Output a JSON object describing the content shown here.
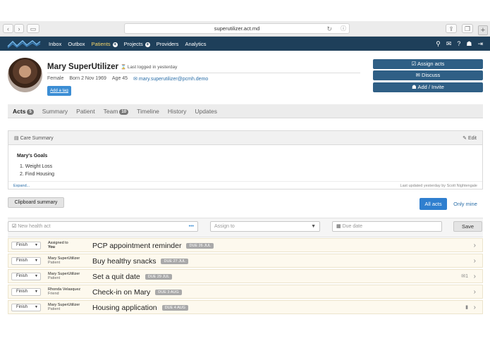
{
  "browser": {
    "url": "superutilizer.act.md"
  },
  "nav": {
    "links": [
      "Inbox",
      "Outbox",
      "Patients",
      "Projects",
      "Providers",
      "Analytics"
    ],
    "active": "Patients"
  },
  "profile": {
    "name": "Mary SuperUtilizer",
    "last_logged": "Last logged in yesterday",
    "gender": "Female",
    "born": "Born 2 Nov 1969",
    "age": "Age 45",
    "email": "mary.superutilizer@pcmh.demo",
    "tag_button": "Add a tag"
  },
  "actions": {
    "assign": "Assign acts",
    "discuss": "Discuss",
    "add_invite": "Add / Invite"
  },
  "tabs": [
    {
      "label": "Acts",
      "badge": "5"
    },
    {
      "label": "Summary",
      "badge": ""
    },
    {
      "label": "Patient",
      "badge": ""
    },
    {
      "label": "Team",
      "badge": "10"
    },
    {
      "label": "Timeline",
      "badge": ""
    },
    {
      "label": "History",
      "badge": ""
    },
    {
      "label": "Updates",
      "badge": ""
    }
  ],
  "care": {
    "title": "Care Summary",
    "edit": "Edit",
    "goals_title": "Mary's Goals",
    "goals": [
      "1.  Weight Loss",
      "2.  Find Housing"
    ],
    "expand": "Expand...",
    "updated": "Last updated yesterday by Scott Nightengale"
  },
  "controls": {
    "clipboard": "Clipboard summary",
    "all_acts": "All acts",
    "only_mine": "Only mine"
  },
  "form": {
    "new_placeholder": "New health act",
    "assign_placeholder": "Assign to",
    "due_placeholder": "Due date",
    "save": "Save"
  },
  "acts": [
    {
      "finish": "Finish",
      "who": "Assigned to",
      "sub": "You",
      "title": "PCP appointment reminder",
      "due": "DUE 26 JUL",
      "extra": ""
    },
    {
      "finish": "Finish",
      "who": "Mary SuperUtilizer",
      "sub": "Patient",
      "title": "Buy healthy snacks",
      "due": "DUE 27 JUL",
      "extra": ""
    },
    {
      "finish": "Finish",
      "who": "Mary SuperUtilizer",
      "sub": "Patient",
      "title": "Set a quit date",
      "due": "DUE 29 JUL",
      "extra": "1"
    },
    {
      "finish": "Finish",
      "who": "Rhonda Velasquez",
      "sub": "Friend",
      "title": "Check-in on Mary",
      "due": "DUE 3 AUG",
      "extra": ""
    },
    {
      "finish": "Finish",
      "who": "Mary SuperUtilizer",
      "sub": "Patient",
      "title": "Housing application",
      "due": "DUE 4 AUG",
      "extra": "doc"
    }
  ]
}
